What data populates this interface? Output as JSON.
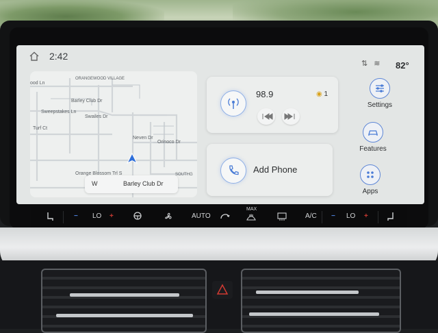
{
  "status": {
    "time": "2:42",
    "temperature": "82°",
    "icons": [
      "home-icon",
      "no-signal-icon",
      "wifi-off-icon"
    ]
  },
  "map": {
    "labels": [
      "ORANGEWOOD VILLAGE",
      "ood Ln",
      "Barley Club Dr",
      "Sweepstakes Ln",
      "Swailes Dr",
      "Turf Ct",
      "Neven Dr",
      "Orinoco Dr",
      "Orange Blossom Trl S",
      "SOUTHG"
    ],
    "direction": "W",
    "current_street": "Barley Club Dr"
  },
  "radio": {
    "frequency": "98.9",
    "preset": "1",
    "icons": [
      "radio-antenna-icon",
      "seek-back-icon",
      "seek-forward-icon",
      "hd-radio-icon"
    ]
  },
  "phone": {
    "label": "Add Phone",
    "icon": "phone-icon"
  },
  "sidebar": {
    "items": [
      {
        "label": "Settings",
        "icon": "settings-sliders-icon"
      },
      {
        "label": "Features",
        "icon": "car-icon"
      },
      {
        "label": "Apps",
        "icon": "apps-grid-icon"
      }
    ]
  },
  "climate": {
    "left_temp": "LO",
    "right_temp": "LO",
    "auto_label": "AUTO",
    "max_label": "MAX",
    "ac_label": "A/C",
    "minus": "−",
    "plus": "+"
  },
  "colors": {
    "accent_blue": "#5d86d6",
    "screen_bg": "#e3e6e5",
    "minus_blue": "#4d7fd8",
    "plus_red": "#c83a33"
  }
}
